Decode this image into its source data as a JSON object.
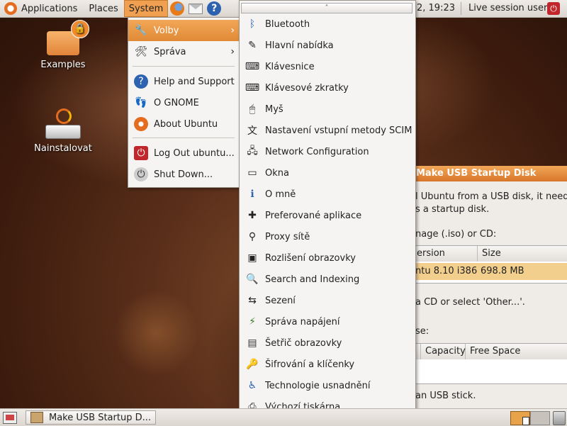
{
  "top_panel": {
    "applications": "Applications",
    "places": "Places",
    "system": "System",
    "clock": "2, 19:23",
    "session_user": "Live session user"
  },
  "desktop": {
    "icons": [
      {
        "label": "Examples",
        "icon": "folder-icon"
      },
      {
        "label": "Nainstalovat",
        "icon": "install-drive-icon"
      }
    ]
  },
  "system_menu": {
    "items": [
      {
        "label": "Volby",
        "icon": "preferences-icon",
        "submenu": true,
        "active": true
      },
      {
        "label": "Správa",
        "icon": "administration-icon",
        "submenu": true
      },
      {
        "label": "Help and Support",
        "icon": "help-icon"
      },
      {
        "label": "O GNOME",
        "icon": "gnome-foot-icon"
      },
      {
        "label": "About Ubuntu",
        "icon": "ubuntu-icon"
      },
      {
        "label": "Log Out ubuntu...",
        "icon": "logout-icon"
      },
      {
        "label": "Shut Down...",
        "icon": "shutdown-icon"
      }
    ]
  },
  "preferences_menu": {
    "scroll_up": "˄",
    "scroll_down": "˅",
    "items": [
      {
        "label": "Bluetooth",
        "icon": "bluetooth-icon"
      },
      {
        "label": "Hlavní nabídka",
        "icon": "main-menu-icon"
      },
      {
        "label": "Klávesnice",
        "icon": "keyboard-icon"
      },
      {
        "label": "Klávesové zkratky",
        "icon": "keyboard-shortcuts-icon"
      },
      {
        "label": "Myš",
        "icon": "mouse-icon"
      },
      {
        "label": "Nastavení vstupní metody SCIM",
        "icon": "scim-icon"
      },
      {
        "label": "Network Configuration",
        "icon": "network-icon"
      },
      {
        "label": "Okna",
        "icon": "windows-icon"
      },
      {
        "label": "O mně",
        "icon": "about-me-icon"
      },
      {
        "label": "Preferované aplikace",
        "icon": "preferred-apps-icon"
      },
      {
        "label": "Proxy sítě",
        "icon": "proxy-icon"
      },
      {
        "label": "Rozlišení obrazovky",
        "icon": "screen-resolution-icon"
      },
      {
        "label": "Search and Indexing",
        "icon": "search-indexing-icon"
      },
      {
        "label": "Sezení",
        "icon": "sessions-icon"
      },
      {
        "label": "Správa napájení",
        "icon": "power-management-icon"
      },
      {
        "label": "Šetřič obrazovky",
        "icon": "screensaver-icon"
      },
      {
        "label": "Šifrování a klíčenky",
        "icon": "encryption-keyrings-icon"
      },
      {
        "label": "Technologie usnadnění",
        "icon": "accessibility-icon"
      },
      {
        "label": "Výchozí tiskárna",
        "icon": "printer-icon"
      }
    ]
  },
  "dialog": {
    "title": "Make USB Startup Disk",
    "intro_line1": "l Ubuntu from a USB disk, it need",
    "intro_line2": "s a startup disk.",
    "source_prompt": "nage (.iso) or CD:",
    "source_columns": [
      "ersion",
      "Size"
    ],
    "source_row": {
      "version": "ntu 8.10 i386",
      "size": "698.8 MB"
    },
    "other_hint": "a CD or select 'Other...'.",
    "disk_prompt": "se:",
    "disk_columns": [
      "Capacity",
      "Free Space"
    ],
    "usb_hint": "an USB stick."
  },
  "bottom_panel": {
    "task_label": "Make USB Startup D..."
  }
}
